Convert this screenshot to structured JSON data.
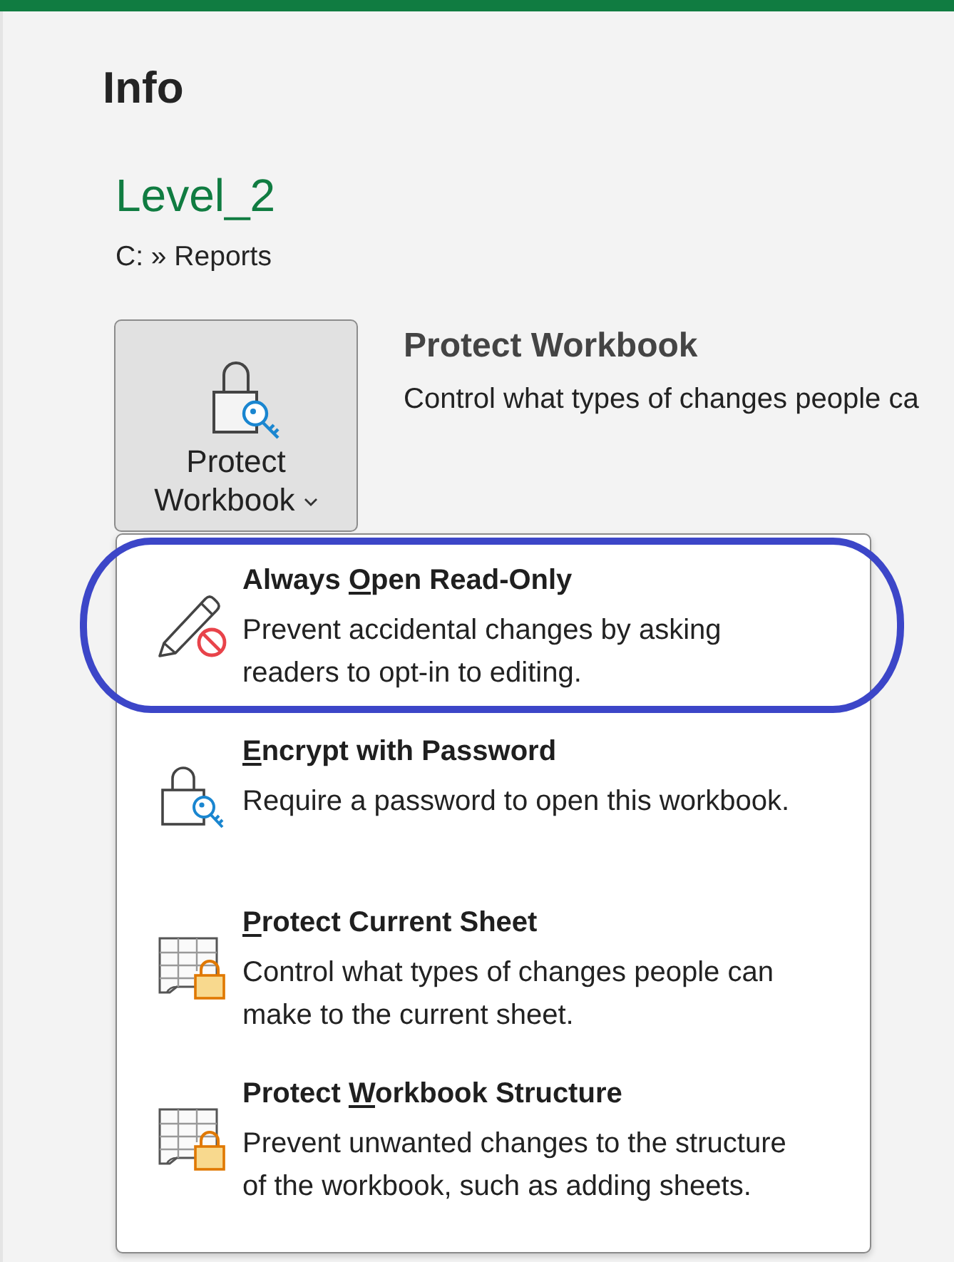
{
  "header": {
    "title": "Info"
  },
  "document": {
    "name": "Level_2",
    "path": "C: » Reports"
  },
  "protect": {
    "button": {
      "label": "Protect Workbook"
    },
    "heading": "Protect Workbook",
    "description": "Control what types of changes people ca"
  },
  "menu": {
    "items": [
      {
        "kind": "pencil",
        "title": {
          "before": "Always ",
          "key": "O",
          "after": "pen Read-Only"
        },
        "description": "Prevent accidental changes by asking readers to opt-in to editing.",
        "highlighted": true
      },
      {
        "kind": "lock",
        "title": {
          "key": "E",
          "after": "ncrypt with Password"
        },
        "description": "Require a password to open this workbook.",
        "highlighted": false
      },
      {
        "kind": "grid",
        "title": {
          "key": "P",
          "after": "rotect Current Sheet"
        },
        "description": "Control what types of changes people can make to the current sheet.",
        "highlighted": false
      },
      {
        "kind": "grid",
        "title": {
          "before": "Protect ",
          "key": "W",
          "after": "orkbook Structure"
        },
        "description": "Prevent unwanted changes to the structure of the workbook, such as adding sheets.",
        "highlighted": false
      }
    ]
  }
}
